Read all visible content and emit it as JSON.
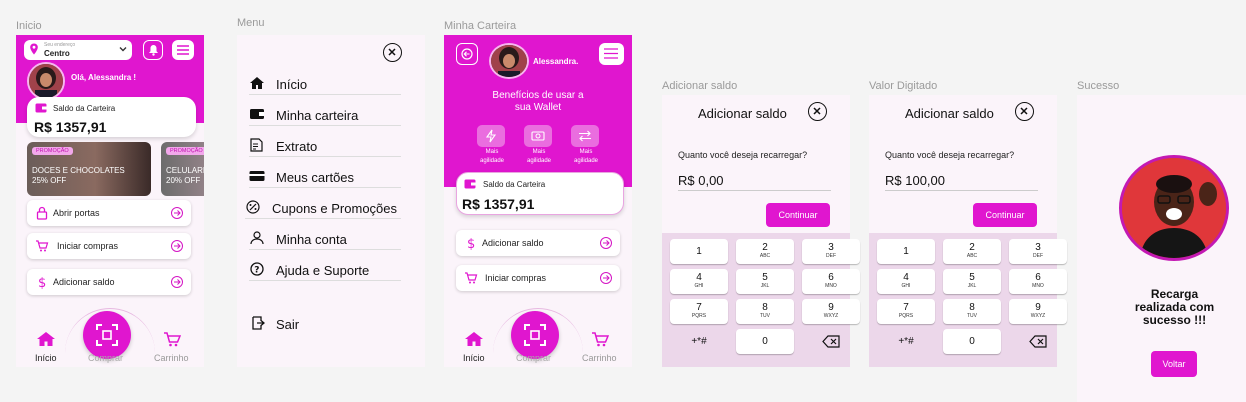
{
  "colors": {
    "primary": "#e016cf",
    "background": "#fbf4fa",
    "canvas": "#f4f4f4"
  },
  "frames": {
    "inicio": "Inicio",
    "menu": "Menu",
    "carteira": "Minha Carteira",
    "adicionar": "Adicionar saldo",
    "valor": "Valor Digitado",
    "sucesso": "Sucesso"
  },
  "home": {
    "location_small": "Seu endereço",
    "location": "Centro",
    "greeting": "Olá, Alessandra !",
    "wallet_title": "Saldo da Carteira",
    "wallet_amount": "R$ 1357,91",
    "promos": [
      {
        "tag": "PROMOÇÃO",
        "line1": "DOCES E CHOCOLATES",
        "line2": "25% OFF"
      },
      {
        "tag": "PROMOÇÃO",
        "line1": "CELULARES",
        "line2": "20% OFF"
      }
    ],
    "actions": [
      {
        "label": "Abrir portas",
        "icon": "lock-icon"
      },
      {
        "label": "Iniciar compras",
        "icon": "cart-icon"
      },
      {
        "label": "Adicionar saldo",
        "icon": "dollar-icon"
      }
    ]
  },
  "nav": {
    "home": "Início",
    "buy": "Comprar",
    "cart": "Carrinho"
  },
  "menu": {
    "items": [
      {
        "label": "Início",
        "icon": "home-icon"
      },
      {
        "label": "Minha carteira",
        "icon": "wallet-icon"
      },
      {
        "label": "Extrato",
        "icon": "receipt-icon"
      },
      {
        "label": "Meus cartões",
        "icon": "card-icon"
      },
      {
        "label": "Cupons e Promoções",
        "icon": "coupon-icon"
      },
      {
        "label": "Minha conta",
        "icon": "user-icon"
      },
      {
        "label": "Ajuda e Suporte",
        "icon": "help-icon"
      }
    ],
    "logout": "Sair"
  },
  "wallet": {
    "name": "Alessandra.",
    "benefits_title_1": "Benefícios de usar a",
    "benefits_title_2": "sua Wallet",
    "benefits": [
      {
        "line1": "Mais",
        "line2": "agilidade",
        "icon": "bolt-icon"
      },
      {
        "line1": "Mais",
        "line2": "agilidade",
        "icon": "money-icon"
      },
      {
        "line1": "Mais",
        "line2": "agilidade",
        "icon": "transfer-icon"
      }
    ],
    "card_title": "Saldo da Carteira",
    "card_amount": "R$ 1357,91",
    "actions": [
      {
        "label": "Adicionar saldo",
        "icon": "dollar-icon"
      },
      {
        "label": "Iniciar compras",
        "icon": "cart-icon"
      }
    ]
  },
  "add_balance": {
    "title": "Adicionar saldo",
    "question": "Quanto você deseja recarregar?",
    "value_empty": "R$ 0,00",
    "value_typed": "R$ 100,00",
    "continue": "Continuar"
  },
  "keypad": [
    {
      "n": "1",
      "s": ""
    },
    {
      "n": "2",
      "s": "ABC"
    },
    {
      "n": "3",
      "s": "DEF"
    },
    {
      "n": "4",
      "s": "GHI"
    },
    {
      "n": "5",
      "s": "JKL"
    },
    {
      "n": "6",
      "s": "MNO"
    },
    {
      "n": "7",
      "s": "PQRS"
    },
    {
      "n": "8",
      "s": "TUV"
    },
    {
      "n": "9",
      "s": "WXYZ"
    },
    {
      "n": "+*#",
      "s": ""
    },
    {
      "n": "0",
      "s": ""
    },
    {
      "n": "",
      "s": ""
    }
  ],
  "success": {
    "line1": "Recarga",
    "line2": "realizada com",
    "line3": "sucesso !!!",
    "back": "Voltar"
  }
}
